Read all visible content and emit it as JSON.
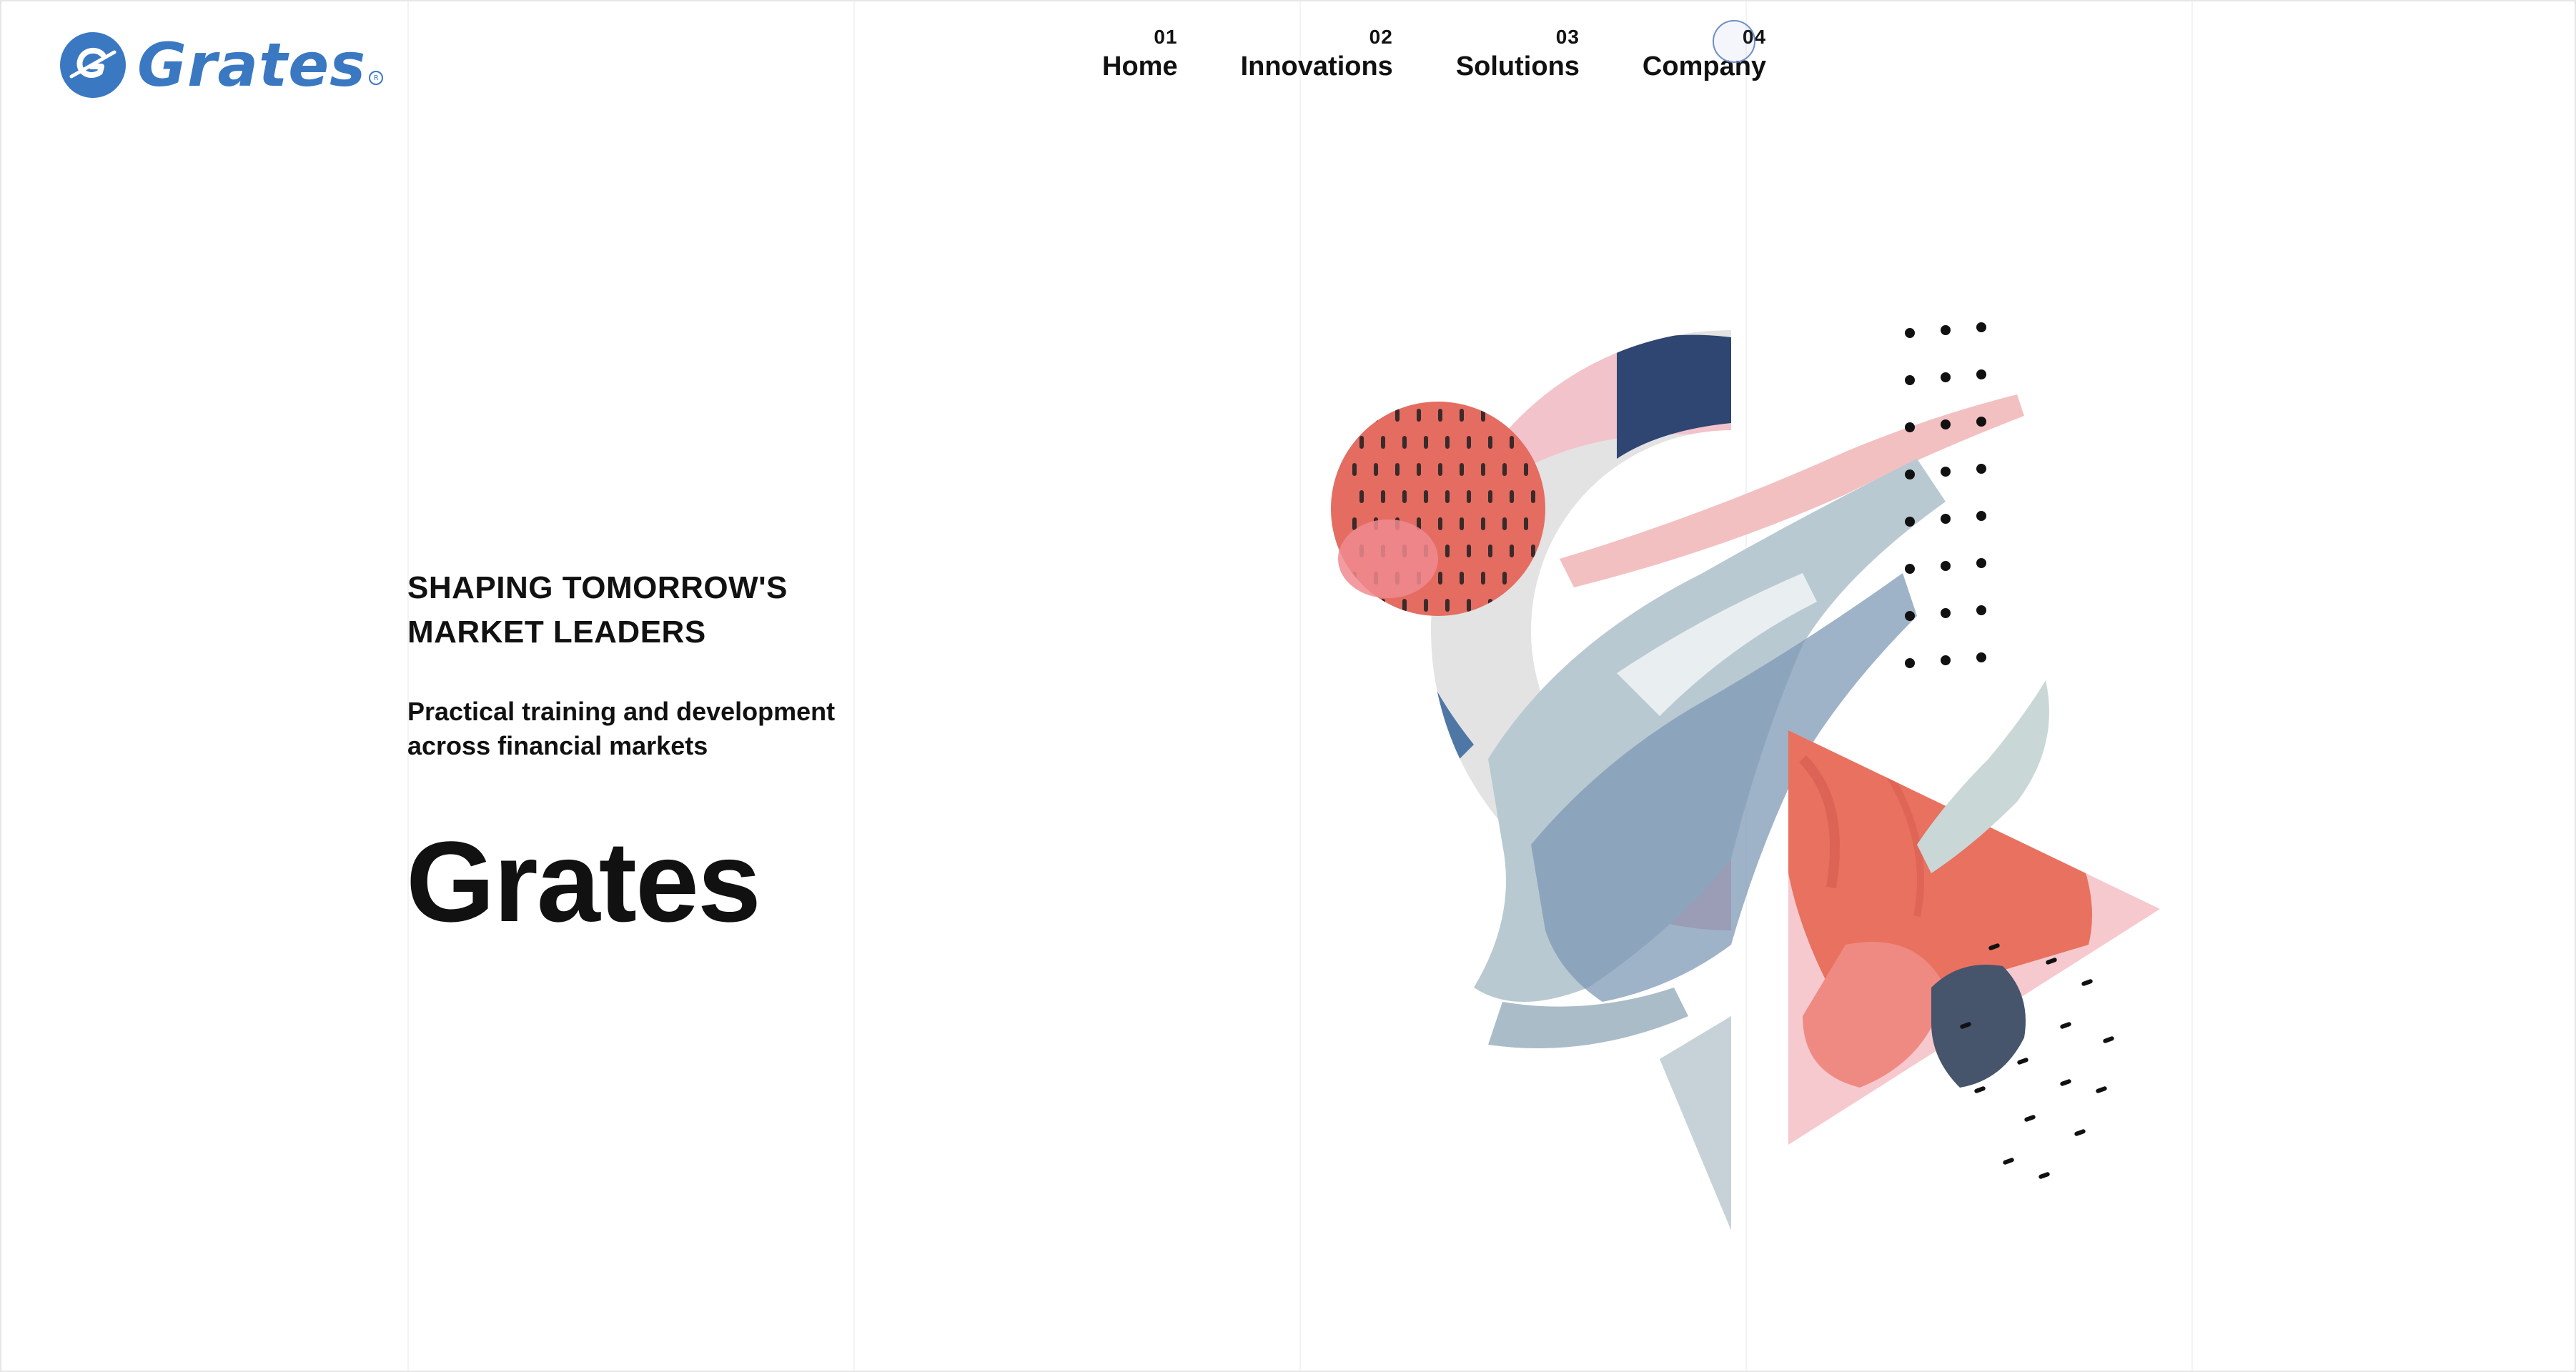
{
  "brand": {
    "logo_text": "Grates",
    "logo_icon": "grates-logo-icon",
    "registered_mark": "R",
    "accent_color": "#3a78c2"
  },
  "nav": {
    "items": [
      {
        "number": "01",
        "label": "Home"
      },
      {
        "number": "02",
        "label": "Innovations"
      },
      {
        "number": "03",
        "label": "Solutions"
      },
      {
        "number": "04",
        "label": "Company"
      }
    ]
  },
  "hero": {
    "tagline_line1": "SHAPING TOMORROW'S",
    "tagline_line2": "MARKET LEADERS",
    "subtitle_line1": "Practical training and development",
    "subtitle_line2": "across financial markets",
    "brand_title": "Grates"
  },
  "artwork": {
    "name": "abstract-painted-shapes",
    "colors": [
      "#e8715f",
      "#33466e",
      "#b9c9d2",
      "#f2b8c0",
      "#dcdcdc"
    ]
  }
}
